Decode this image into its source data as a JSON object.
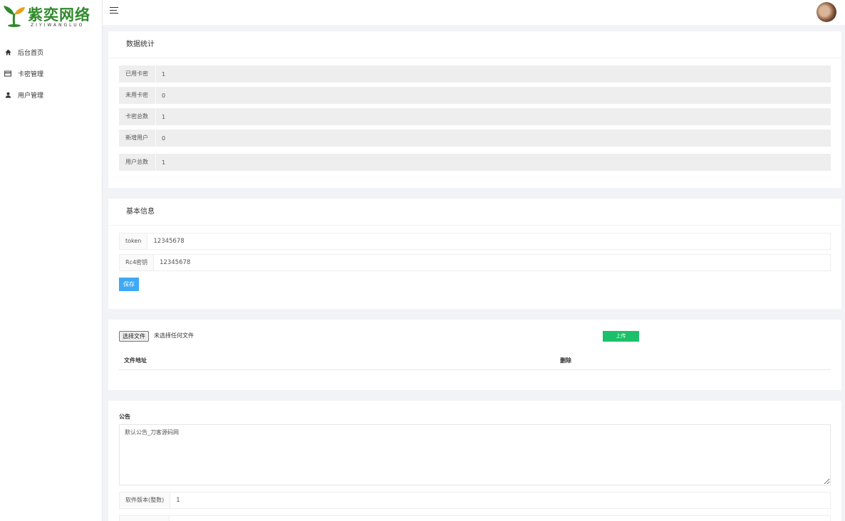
{
  "brand": {
    "name": "紫奕网络",
    "subtitle": "ZIYIWANGLUO",
    "color": "#2f8a2a"
  },
  "sidebar": {
    "items": [
      {
        "label": "后台首页",
        "icon": "home-icon"
      },
      {
        "label": "卡密管理",
        "icon": "card-icon"
      },
      {
        "label": "用户管理",
        "icon": "user-icon"
      }
    ]
  },
  "header": {
    "menu_icon": "hamburger-icon",
    "avatar": "user-avatar"
  },
  "stats": {
    "title": "数据统计",
    "rows": [
      {
        "label": "已用卡密",
        "value": "1"
      },
      {
        "label": "未用卡密",
        "value": "0"
      },
      {
        "label": "卡密总数",
        "value": "1"
      },
      {
        "label": "新增用户",
        "value": "0"
      },
      {
        "label": "用户总数",
        "value": "1"
      }
    ]
  },
  "basic": {
    "title": "基本信息",
    "token_label": "token",
    "token_value": "12345678",
    "rc4_label": "Rc4密钥",
    "rc4_value": "12345678",
    "save_label": "保存"
  },
  "upload": {
    "choose_label": "选择文件",
    "no_file": "未选择任何文件",
    "upload_label": "上传",
    "col_address": "文件地址",
    "col_delete": "删除"
  },
  "notice": {
    "label": "公告",
    "value": "默认公告_刀客源码网",
    "version_label": "软件版本(整数)",
    "version_value": "1"
  },
  "colors": {
    "accent_blue": "#3ea9f5",
    "accent_green": "#1cc06a"
  }
}
